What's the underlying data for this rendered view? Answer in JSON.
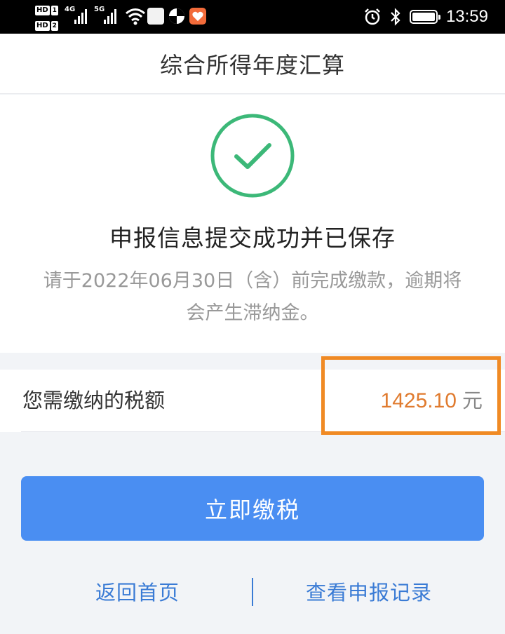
{
  "status_bar": {
    "hd1": "HD",
    "hd1_sim": "1",
    "hd2": "HD",
    "hd2_sim": "2",
    "net1": "4G",
    "net2": "5G",
    "time": "13:59"
  },
  "header": {
    "title": "综合所得年度汇算"
  },
  "result": {
    "title": "申报信息提交成功并已保存",
    "description": "请于2022年06月30日（含）前完成缴款，逾期将会产生滞纳金。"
  },
  "tax": {
    "label": "您需缴纳的税额",
    "amount": "1425.10",
    "unit": "元"
  },
  "actions": {
    "pay_label": "立即缴税",
    "home_label": "返回首页",
    "records_label": "查看申报记录"
  },
  "colors": {
    "success_green": "#3cb878",
    "amount_orange": "#e07b2f",
    "primary_blue": "#4a8ef2",
    "link_blue": "#3a7bd5",
    "highlight": "#f08a24"
  }
}
